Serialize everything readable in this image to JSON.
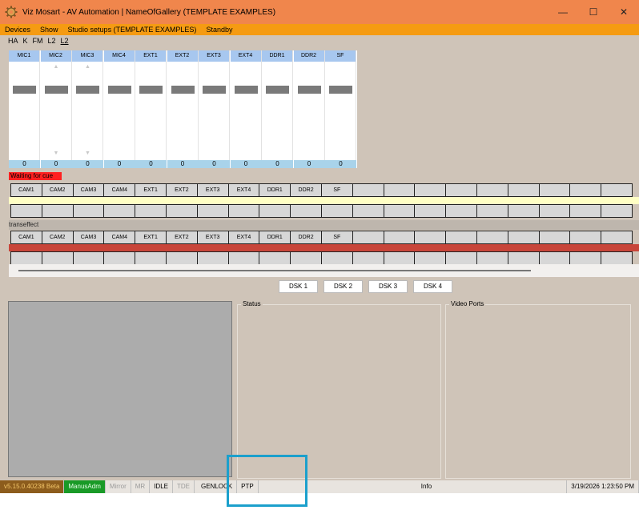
{
  "window": {
    "title": "Viz Mosart - AV Automation | NameOfGallery (TEMPLATE EXAMPLES)",
    "icon": "gear-icon",
    "controls": [
      "—",
      "☐",
      "✕"
    ]
  },
  "menu": [
    "Devices",
    "Show",
    "Studio setups (TEMPLATE EXAMPLES)",
    "Standby"
  ],
  "modes": [
    "HA",
    "K",
    "FM",
    "L2",
    "L2"
  ],
  "mixer": {
    "channels": [
      {
        "name": "MIC1",
        "value": "0",
        "arrows": false
      },
      {
        "name": "MIC2",
        "value": "0",
        "arrows": true
      },
      {
        "name": "MIC3",
        "value": "0",
        "arrows": true
      },
      {
        "name": "MIC4",
        "value": "0",
        "arrows": false
      },
      {
        "name": "EXT1",
        "value": "0",
        "arrows": false
      },
      {
        "name": "EXT2",
        "value": "0",
        "arrows": false
      },
      {
        "name": "EXT3",
        "value": "0",
        "arrows": false
      },
      {
        "name": "EXT4",
        "value": "0",
        "arrows": false
      },
      {
        "name": "DDR1",
        "value": "0",
        "arrows": false
      },
      {
        "name": "DDR2",
        "value": "0",
        "arrows": false
      },
      {
        "name": "SF",
        "value": "0",
        "arrows": false
      }
    ]
  },
  "waiting_label": "Waiting for cue",
  "transeffect_label": "transeffect",
  "buses": {
    "sources": [
      "CAM1",
      "CAM2",
      "CAM3",
      "CAM4",
      "EXT1",
      "EXT2",
      "EXT3",
      "EXT4",
      "DDR1",
      "DDR2",
      "SF",
      "",
      "",
      "",
      "",
      "",
      "",
      "",
      "",
      ""
    ],
    "empty": [
      "",
      "",
      "",
      "",
      "",
      "",
      "",
      "",
      "",
      "",
      "",
      "",
      "",
      "",
      "",
      "",
      "",
      "",
      "",
      ""
    ]
  },
  "dsk": [
    "DSK 1",
    "DSK 2",
    "DSK 3",
    "DSK 4"
  ],
  "panels": {
    "status": "Status",
    "video_ports": "Video Ports"
  },
  "statusbar": {
    "version": "v5.15.0.40238 Beta",
    "user": "ManusAdm",
    "mirror": "Mirror",
    "mr": "MR",
    "idle": "IDLE",
    "tde": "TDE",
    "genlock": "GENLOCK",
    "ptp": "PTP",
    "info": "Info",
    "time": "3/19/2026 1:23:50 PM"
  },
  "colors": {
    "titlebar": "#f0864c",
    "menubar": "#f59b12",
    "background": "#cfc4b8",
    "channel_header": "#a7c7ef",
    "waiting": "#ff2020",
    "preview_strip": "#ffffc4",
    "program_strip": "#c8453a",
    "highlight": "#1ba0cc"
  }
}
